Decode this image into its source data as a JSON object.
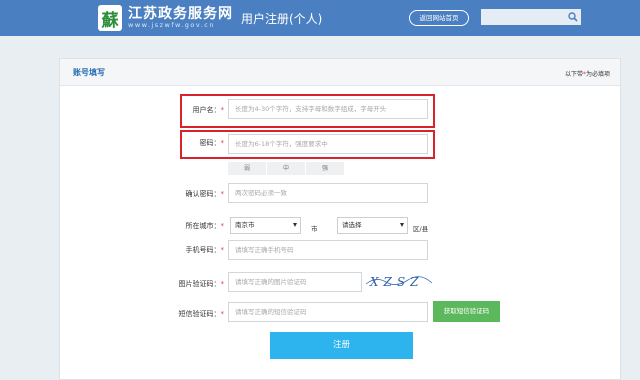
{
  "header": {
    "logo_glyph": "蘇",
    "site_name": "江苏政务服务网",
    "site_url": "www.jszwfw.gov.cn",
    "page_title": "用户注册(个人)",
    "home_label": "返回网站首页",
    "search_icon": "search-icon",
    "color": "#4a7fc1"
  },
  "panel": {
    "title": "账号填写",
    "req_note_pre": "以下带",
    "req_star": "*",
    "req_note_post": "为必填项"
  },
  "form": {
    "star": "*",
    "username": {
      "label": "用户名：",
      "placeholder": "长度为4-30个字符，支持字母和数字组成，字母开头"
    },
    "password": {
      "label": "密码：",
      "placeholder": "长度为6-18个字符，强度要求中"
    },
    "strength": [
      "弱",
      "中",
      "强"
    ],
    "confirm": {
      "label": "确认密码：",
      "placeholder": "两次密码必须一致"
    },
    "city": {
      "label": "所在城市：",
      "city_value": "南京市",
      "city_unit": "市",
      "district_value": "请选择",
      "district_unit": "区/县"
    },
    "phone": {
      "label": "手机号码：",
      "placeholder": "请填写正确手机号码"
    },
    "image_code": {
      "label": "图片验证码：",
      "placeholder": "请填写正确的图片验证码",
      "captcha_text": "XZSZ"
    },
    "sms_code": {
      "label": "短信验证码：",
      "placeholder": "请填写正确的短信验证码",
      "button": "获取短信验证码"
    },
    "submit": "注册"
  },
  "colors": {
    "accent": "#2db4ee",
    "sms_button": "#5cb85c",
    "highlight": "#d9232a",
    "required": "#e4393c"
  }
}
